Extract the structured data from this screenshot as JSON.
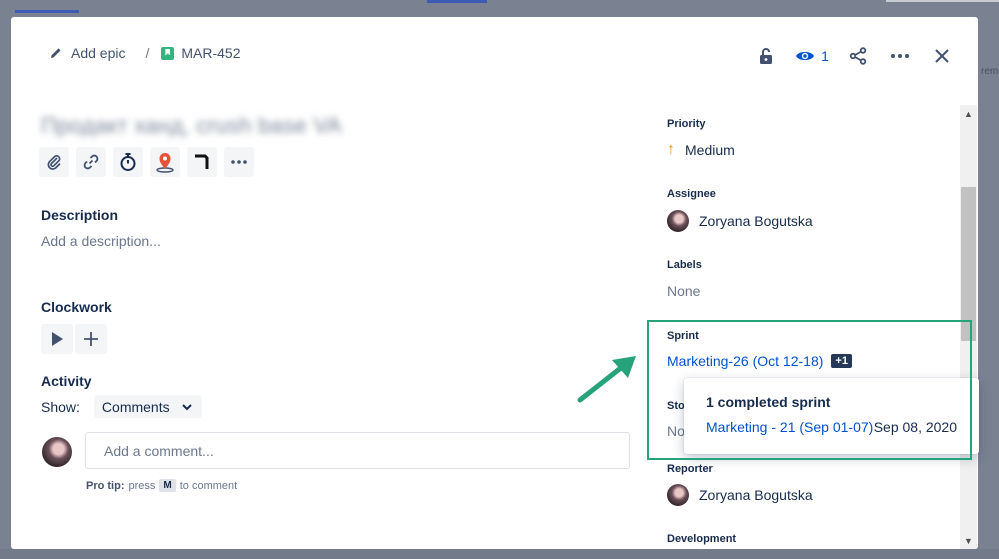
{
  "background": {
    "side_text": "rem"
  },
  "header": {
    "add_epic_label": "Add epic",
    "separator": "/",
    "issue_key": "MAR-452",
    "watch_count": "1"
  },
  "issue": {
    "title": "Продакт ханд, crush base VA"
  },
  "description": {
    "label": "Description",
    "placeholder": "Add a description..."
  },
  "clockwork": {
    "label": "Clockwork"
  },
  "activity": {
    "label": "Activity",
    "show_label": "Show:",
    "show_value": "Comments",
    "comment_placeholder": "Add a comment...",
    "pro_tip_label": "Pro tip:",
    "pro_tip_pre": "press",
    "pro_tip_key": "M",
    "pro_tip_post": "to comment"
  },
  "fields": {
    "priority_label": "Priority",
    "priority_value": "Medium",
    "assignee_label": "Assignee",
    "assignee_value": "Zoryana Bogutska",
    "labels_label": "Labels",
    "labels_value": "None",
    "sprint_label": "Sprint",
    "sprint_value": "Marketing-26 (Oct 12-18)",
    "sprint_extra": "+1",
    "story_label_partial": "Stor",
    "story_value_partial": "No",
    "reporter_label": "Reporter",
    "reporter_value": "Zoryana Bogutska",
    "development_label": "Development"
  },
  "sprint_popup": {
    "title": "1 completed sprint",
    "sprint_name": "Marketing - 21 (Sep 01-07)",
    "date": "Sep 08, 2020"
  },
  "colors": {
    "accent": "#0052cc",
    "highlight": "#26a37a",
    "priority": "#f38b1a"
  }
}
